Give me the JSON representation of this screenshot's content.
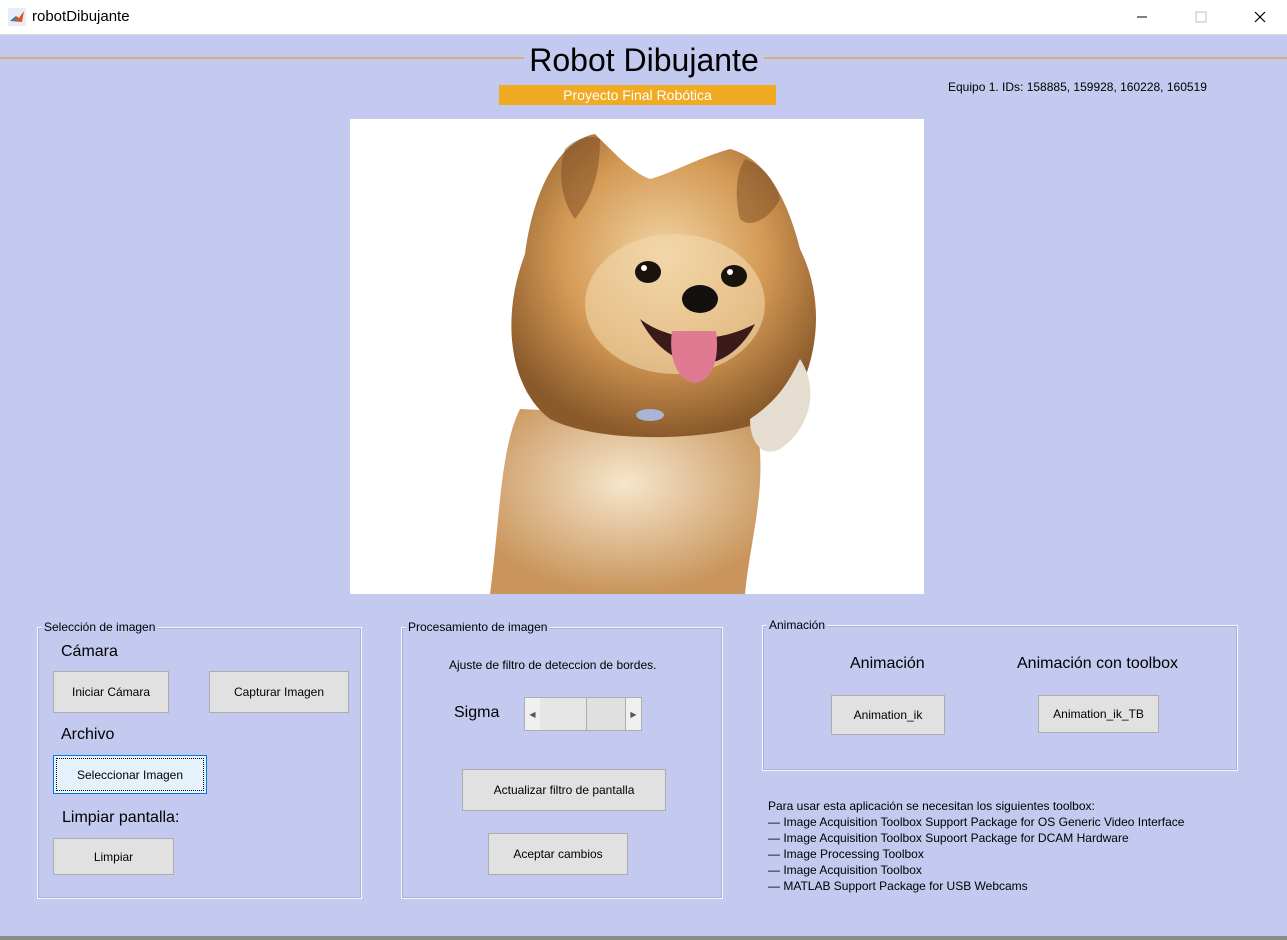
{
  "window": {
    "title": "robotDibujante",
    "controls": [
      "minimize-icon",
      "maximize-icon",
      "close-icon"
    ]
  },
  "header": {
    "title": "Robot Dibujante",
    "subtitle": "Proyecto Final Robótica",
    "team": "Equipo 1. IDs: 158885, 159928, 160228, 160519"
  },
  "image_area": {
    "content": "dog-photo"
  },
  "seleccion": {
    "title": "Selección de imagen",
    "camara_label": "Cámara",
    "iniciar_btn": "Iniciar Cámara",
    "capturar_btn": "Capturar Imagen",
    "archivo_label": "Archivo",
    "seleccionar_btn": "Seleccionar Imagen",
    "limpiar_label": "Limpiar pantalla:",
    "limpiar_btn": "Limpiar"
  },
  "procesamiento": {
    "title": "Procesamiento de imagen",
    "ajuste_label": "Ajuste de filtro de deteccion de bordes.",
    "sigma_label": "Sigma",
    "actualizar_btn": "Actualizar filtro de pantalla",
    "aceptar_btn": "Aceptar cambios"
  },
  "animacion": {
    "title": "Animación",
    "col1_label": "Animación",
    "col2_label": "Animación con toolbox",
    "btn1": "Animation_ik",
    "btn2": "Animation_ik_TB"
  },
  "requirements": {
    "intro": "Para usar esta aplicación se necesitan los siguientes toolbox:",
    "items": [
      "— Image Acquisition Toolbox Support Package for OS Generic Video Interface",
      "— Image Acquisition Toolbox Supoort Package for DCAM Hardware",
      "— Image Processing Toolbox",
      "— Image Acquisition Toolbox",
      "— MATLAB Support Package for USB Webcams"
    ]
  },
  "colors": {
    "background": "#c3c9ef",
    "subtitle_bg": "#f0ab22",
    "header_line": "#d4b178"
  }
}
